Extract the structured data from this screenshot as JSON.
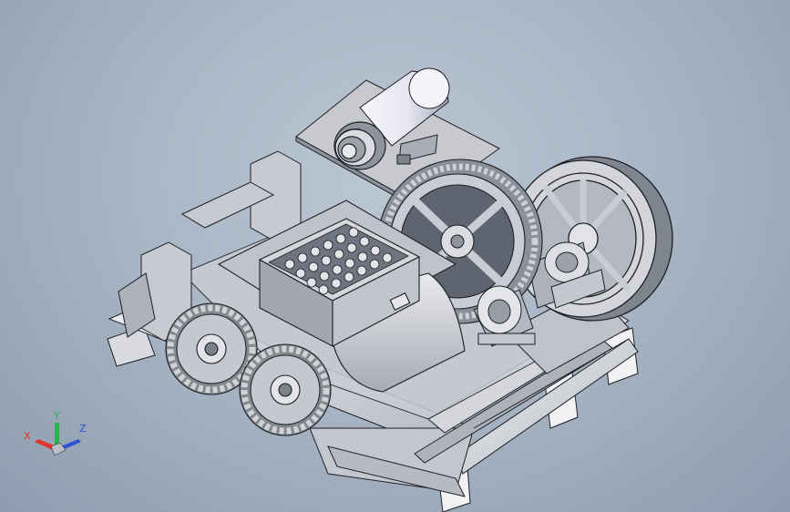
{
  "viewport": {
    "background_top": "#bcc7d4",
    "background_bottom": "#8d9caf"
  },
  "model": {
    "part_color": "#cfd1d6",
    "shadow_color": "#8e939c",
    "edge_color": "#1c1f26",
    "components": [
      "motor",
      "motor-base-plate",
      "drive-pulley",
      "flywheel",
      "large-spur-gear",
      "left-bearing-block",
      "crusher-housing",
      "toothed-rolls",
      "front-gear-pair",
      "base-frame",
      "support-feet"
    ]
  },
  "triad": {
    "x_label": "X",
    "y_label": "Y",
    "z_label": "Z",
    "x_color": "#e0342b",
    "y_color": "#29b34a",
    "z_color": "#2a55d6"
  }
}
